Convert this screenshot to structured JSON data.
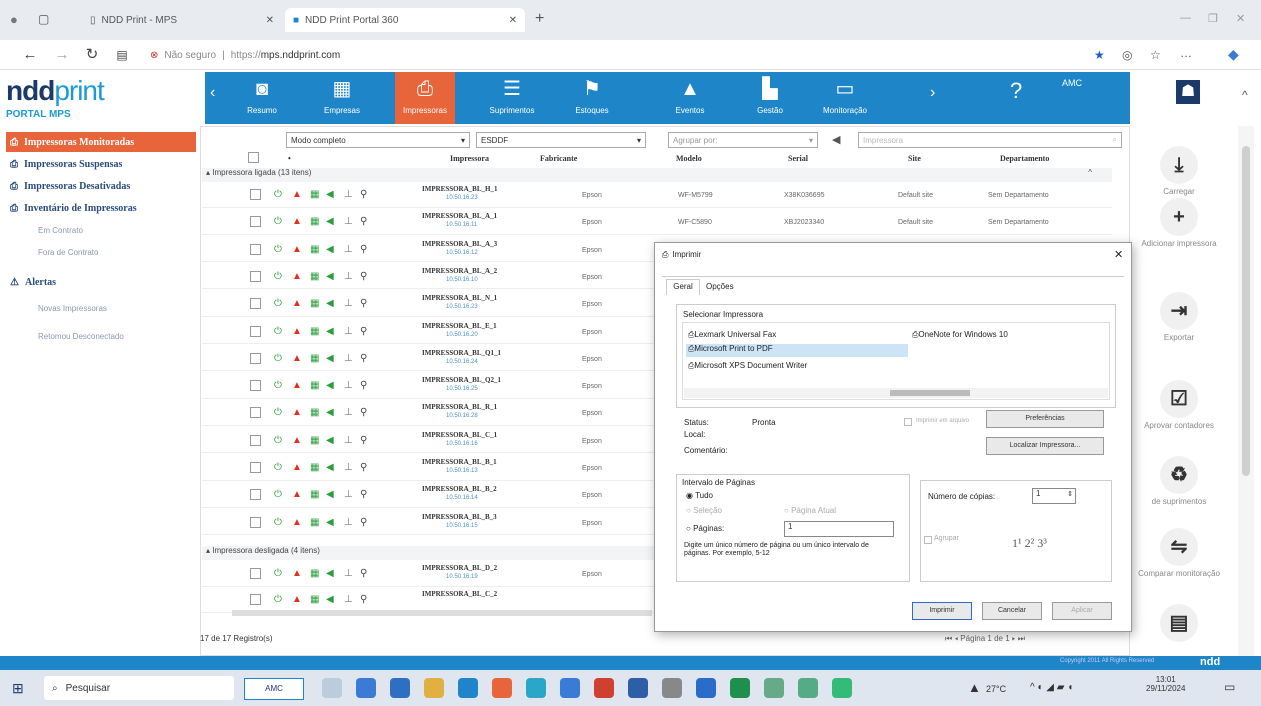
{
  "browser": {
    "tabs": [
      "NDD Print - MPS",
      "NDD Print Portal 360"
    ],
    "insecure_label": "Não seguro",
    "url_prefix": "https://",
    "url_host": "mps.nddprint.com"
  },
  "brand": {
    "logo_bold": "ndd",
    "logo_light": "print",
    "subtitle": "PORTAL MPS"
  },
  "topnav": {
    "items": [
      "Resumo",
      "Empresas",
      "Impressoras",
      "Suprimentos",
      "Estoques",
      "Eventos",
      "Gestão",
      "Monitoração"
    ],
    "active": "Impressoras",
    "user": "AMC"
  },
  "sidebar": {
    "items": [
      "Impressoras Monitoradas",
      "Impressoras Suspensas",
      "Impressoras Desativadas",
      "Inventário de Impressoras"
    ],
    "sub_inventory": [
      "Em Contrato",
      "Fora de Contrato"
    ],
    "alerts": "Alertas",
    "sub_alerts": [
      "Novas Impressoras",
      "Retomou Desconectado"
    ]
  },
  "toolbar": {
    "mode": "Modo completo",
    "company": "ESDDF",
    "group_by": "Agrupar por:",
    "search_placeholder": "Impressora"
  },
  "columns": [
    "Impressora",
    "Fabricante",
    "Modelo",
    "Serial",
    "Site",
    "Departamento"
  ],
  "groups": {
    "on": "Impressora ligada (13 itens)",
    "off": "Impressora desligada (4 itens)"
  },
  "rows": [
    {
      "name": "IMPRESSORA_BL_H_1",
      "ip": "10.50.16.23",
      "maker": "Epson",
      "model": "WF-M5799",
      "serial": "X38K036695",
      "site": "Default site",
      "dept": "Sem Departamento"
    },
    {
      "name": "IMPRESSORA_BL_A_1",
      "ip": "10.50.16.11",
      "maker": "Epson",
      "model": "WF-C5890",
      "serial": "XBJ2023340",
      "site": "Default site",
      "dept": "Sem Departamento"
    },
    {
      "name": "IMPRESSORA_BL_A_3",
      "ip": "10.50.16.12",
      "maker": "Epson"
    },
    {
      "name": "IMPRESSORA_BL_A_2",
      "ip": "10.50.16.10",
      "maker": "Epson"
    },
    {
      "name": "IMPRESSORA_BL_N_1",
      "ip": "10.50.16.23",
      "maker": "Epson"
    },
    {
      "name": "IMPRESSORA_BL_E_1",
      "ip": "10.50.16.20",
      "maker": "Epson"
    },
    {
      "name": "IMPRESSORA_BL_Q1_1",
      "ip": "10.50.16.24",
      "maker": "Epson"
    },
    {
      "name": "IMPRESSORA_BL_Q2_1",
      "ip": "10.50.16.25",
      "maker": "Epson"
    },
    {
      "name": "IMPRESSORA_BL_R_1",
      "ip": "10.50.16.28",
      "maker": "Epson"
    },
    {
      "name": "IMPRESSORA_BL_C_1",
      "ip": "10.50.16.16",
      "maker": "Epson"
    },
    {
      "name": "IMPRESSORA_BL_B_1",
      "ip": "10.50.16.13",
      "maker": "Epson"
    },
    {
      "name": "IMPRESSORA_BL_B_2",
      "ip": "10.50.16.14",
      "maker": "Epson"
    },
    {
      "name": "IMPRESSORA_BL_B_3",
      "ip": "10.50.16.15",
      "maker": "Epson"
    }
  ],
  "off_rows": [
    {
      "name": "IMPRESSORA_BL_D_2",
      "ip": "10.50.16.19",
      "maker": "Epson"
    },
    {
      "name": "IMPRESSORA_BL_C_2",
      "ip": "",
      "maker": ""
    }
  ],
  "footer": {
    "records": "17 de 17 Registro(s)",
    "pager": "Página 1 de 1",
    "copyright": "Copyright 2011 All Rights Reserved",
    "brand": "ndd"
  },
  "actions": [
    "Carregar",
    "Adicionar impressora",
    "Exportar",
    "Aprovar contadores",
    "de suprimentos",
    "Comparar monitoração"
  ],
  "dialog": {
    "title": "Imprimir",
    "tabs": [
      "Geral",
      "Opções"
    ],
    "select_printer": "Selecionar Impressora",
    "printers": [
      "Lexmark Universal Fax",
      "Microsoft Print to PDF",
      "Microsoft XPS Document Writer",
      "OneNote for Windows 10"
    ],
    "status_label": "Status:",
    "status_value": "Pronta",
    "local_label": "Local:",
    "comment_label": "Comentário:",
    "print_to_file": "Imprimir em arquivo",
    "preferences": "Preferências",
    "find_printer": "Localizar Impressora...",
    "range_title": "Intervalo de Páginas",
    "all": "Tudo",
    "selection": "Seleção",
    "current_page": "Página Atual",
    "pages": "Páginas:",
    "pages_value": "1",
    "hint": "Digite um único número de página ou um único intervalo de páginas. Por exemplo, 5-12",
    "copies_label": "Número de cópias:",
    "copies_value": "1",
    "collate": "Agrupar",
    "print_btn": "Imprimir",
    "cancel_btn": "Cancelar",
    "apply_btn": "Aplicar"
  },
  "taskbar": {
    "search": "Pesquisar",
    "temp": "27°C",
    "time": "13:01",
    "date": "29/11/2024"
  }
}
